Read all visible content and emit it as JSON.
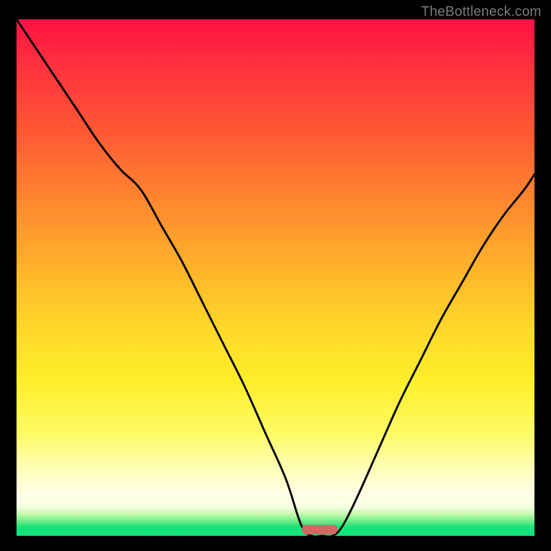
{
  "watermark": {
    "text": "TheBottleneck.com"
  },
  "colors": {
    "curve": "#000000",
    "marker": "#cf6a63",
    "background_top": "#ff1243",
    "background_bottom": "#12e27a"
  },
  "chart_data": {
    "type": "line",
    "title": "",
    "xlabel": "",
    "ylabel": "",
    "xlim": [
      0,
      100
    ],
    "ylim": [
      0,
      100
    ],
    "axes_visible": false,
    "grid": false,
    "legend": false,
    "marker": {
      "x_start": 55,
      "x_end": 62,
      "y": 0
    },
    "series": [
      {
        "name": "bottleneck-curve",
        "x": [
          0,
          4,
          8,
          12,
          16,
          20,
          24,
          28,
          32,
          36,
          40,
          44,
          48,
          52,
          55,
          57,
          59,
          61,
          63,
          66,
          70,
          74,
          78,
          82,
          86,
          90,
          94,
          98,
          100
        ],
        "y": [
          100,
          94,
          88,
          82,
          76,
          71,
          67,
          60,
          53,
          45,
          37,
          29,
          20,
          11,
          2,
          0,
          0,
          0,
          2,
          8,
          17,
          26,
          34,
          42,
          49,
          56,
          62,
          67,
          70
        ]
      }
    ]
  }
}
